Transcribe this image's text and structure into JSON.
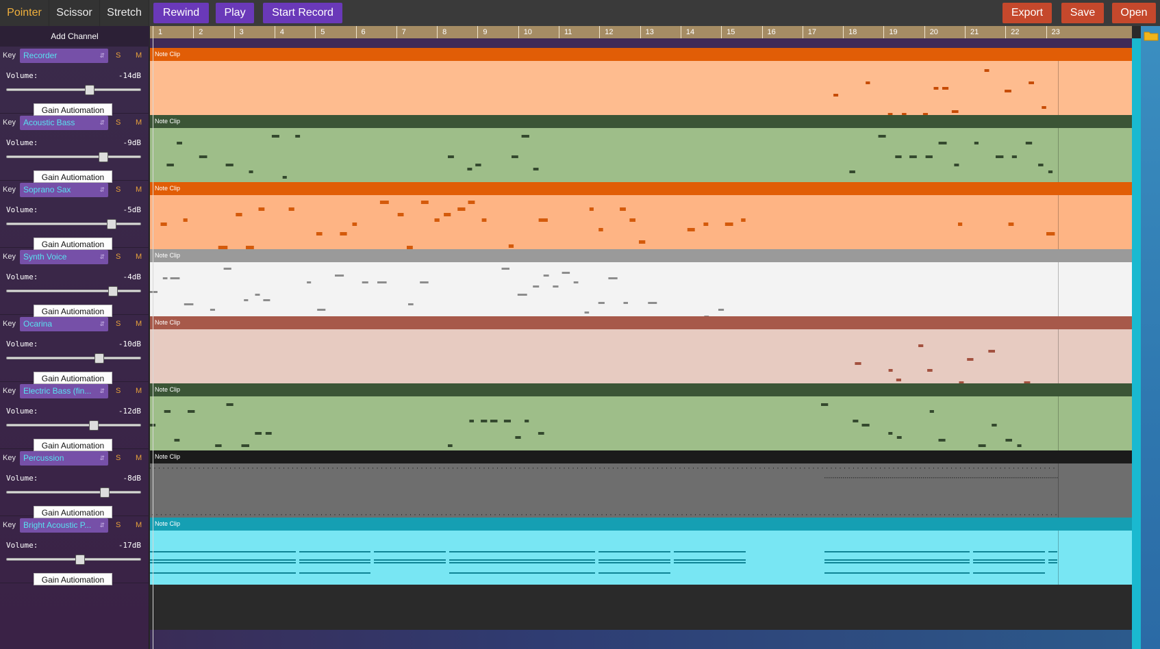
{
  "toolbar": {
    "tools": [
      {
        "label": "Pointer",
        "active": true
      },
      {
        "label": "Scissor",
        "active": false
      },
      {
        "label": "Stretch",
        "active": false
      }
    ],
    "rewind_label": "Rewind",
    "play_label": "Play",
    "record_label": "Start Record",
    "export_label": "Export",
    "save_label": "Save",
    "open_label": "Open"
  },
  "sidebar": {
    "add_channel_label": "Add Channel",
    "key_label": "Key",
    "solo_label": "S",
    "mute_label": "M",
    "volume_label": "Volume:",
    "gain_label": "Gain Autiomation",
    "channels": [
      {
        "instrument": "Recorder",
        "volume": "-14dB",
        "slider_pct": 62
      },
      {
        "instrument": "Acoustic Bass",
        "volume": "-9dB",
        "slider_pct": 72
      },
      {
        "instrument": "Soprano Sax",
        "volume": "-5dB",
        "slider_pct": 78
      },
      {
        "instrument": "Synth Voice",
        "volume": "-4dB",
        "slider_pct": 79
      },
      {
        "instrument": "Ocarina",
        "volume": "-10dB",
        "slider_pct": 69
      },
      {
        "instrument": "Electric Bass (fin...",
        "volume": "-12dB",
        "slider_pct": 65
      },
      {
        "instrument": "Percussion",
        "volume": "-8dB",
        "slider_pct": 73
      },
      {
        "instrument": "Bright Acoustic P...",
        "volume": "-17dB",
        "slider_pct": 55
      }
    ]
  },
  "timeline": {
    "bars": [
      "1",
      "2",
      "3",
      "4",
      "5",
      "6",
      "7",
      "8",
      "9",
      "10",
      "11",
      "12",
      "13",
      "14",
      "15",
      "16",
      "17",
      "18",
      "19",
      "20",
      "21",
      "22",
      "23"
    ],
    "clip_label": "Note Clip",
    "track_colors": [
      {
        "head": "#e15d06",
        "body": "#febc8f",
        "note": "#c64c06"
      },
      {
        "head": "#3b5536",
        "body": "#9ebe89",
        "note": "#34492e"
      },
      {
        "head": "#e15d06",
        "body": "#feb484",
        "note": "#d45a0b"
      },
      {
        "head": "#9a9a9a",
        "body": "#f3f3f3",
        "note": "#8c8c8c"
      },
      {
        "head": "#a7594a",
        "body": "#e7cbc1",
        "note": "#a3513f"
      },
      {
        "head": "#3b5536",
        "body": "#9ebe89",
        "note": "#34492e"
      },
      {
        "head": "#1b1b1b",
        "body": "#6e6e6e",
        "note": "#2b2b2b"
      },
      {
        "head": "#159fb3",
        "body": "#78e6f3",
        "note": "#0f8394"
      }
    ]
  }
}
